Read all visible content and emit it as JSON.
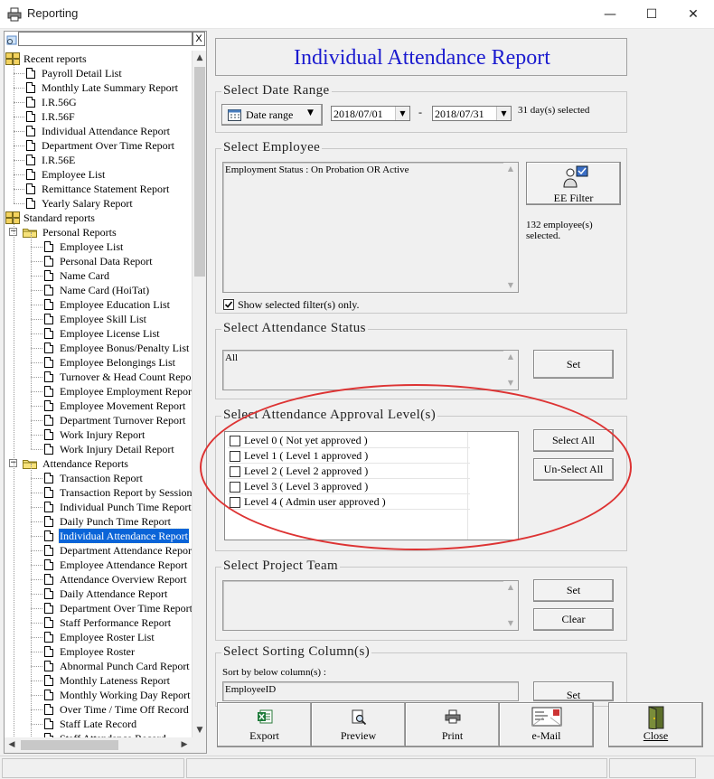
{
  "window": {
    "title": "Reporting",
    "minimize": "—",
    "maximize": "☐",
    "close": "✕"
  },
  "tree": {
    "search_value": "",
    "search_clear": "X",
    "recent": {
      "label": "Recent reports",
      "items": [
        "Payroll Detail List",
        "Monthly Late Summary Report",
        "I.R.56G",
        "I.R.56F",
        "Individual Attendance Report",
        "Department Over Time Report",
        "I.R.56E",
        "Employee List",
        "Remittance Statement Report",
        "Yearly Salary Report"
      ]
    },
    "standard": {
      "label": "Standard reports",
      "personal": {
        "label": "Personal Reports",
        "items": [
          "Employee List",
          "Personal Data Report",
          "Name Card",
          "Name Card (HoiTat)",
          "Employee Education List",
          "Employee Skill List",
          "Employee License List",
          "Employee Bonus/Penalty List",
          "Employee Belongings List",
          "Turnover & Head Count Repo",
          "Employee Employment Repor",
          "Employee Movement Report",
          "Department Turnover Report",
          "Work Injury Report",
          "Work Injury Detail Report"
        ]
      },
      "attendance": {
        "label": "Attendance Reports",
        "items": [
          "Transaction Report",
          "Transaction Report by Session",
          "Individual Punch Time Report",
          "Daily Punch Time Report",
          "Individual Attendance Report",
          "Department Attendance Report",
          "Employee Attendance Report",
          "Attendance Overview Report",
          "Daily Attendance Report",
          "Department Over Time Report",
          "Staff Performance Report",
          "Employee Roster List",
          "Employee Roster",
          "Abnormal Punch Card Report",
          "Monthly Lateness Report",
          "Monthly Working Day Report",
          "Over Time / Time Off Record",
          "Staff Late Record",
          "Staff Attendance Record"
        ],
        "selected_index": 4
      }
    }
  },
  "report": {
    "title": "Individual Attendance Report",
    "date_range": {
      "group_title": "Select Date Range",
      "mode_label": "Date range",
      "from": "2018/07/01",
      "separator": "-",
      "to": "2018/07/31",
      "summary": "31 day(s) selected"
    },
    "employee": {
      "group_title": "Select Employee",
      "filter_text": "Employment Status : On Probation OR Active",
      "filter_button": "EE Filter",
      "count_text": "132 employee(s) selected.",
      "show_filter_label": "Show selected filter(s) only.",
      "show_filter_checked": true
    },
    "attendance_status": {
      "group_title": "Select Attendance Status",
      "value": "All",
      "set_button": "Set"
    },
    "approval": {
      "group_title": "Select Attendance Approval Level(s)",
      "levels": [
        "Level 0 ( Not yet approved )",
        "Level 1 ( Level 1 approved )",
        "Level 2 ( Level 2 approved )",
        "Level 3 ( Level 3 approved )",
        "Level 4 ( Admin user approved )"
      ],
      "select_all": "Select All",
      "unselect_all": "Un-Select All"
    },
    "project_team": {
      "group_title": "Select Project Team",
      "set_button": "Set",
      "clear_button": "Clear"
    },
    "sorting": {
      "group_title": "Select Sorting Column(s)",
      "caption": "Sort by below column(s) :",
      "value": "EmployeeID",
      "set_button": "Set"
    }
  },
  "toolbar": {
    "export": "Export",
    "preview": "Preview",
    "print": "Print",
    "email": "e-Mail",
    "close": "Close"
  },
  "colors": {
    "title_blue": "#1b1bcf",
    "selection_blue": "#0a64d8",
    "annotation_red": "#d33333"
  }
}
